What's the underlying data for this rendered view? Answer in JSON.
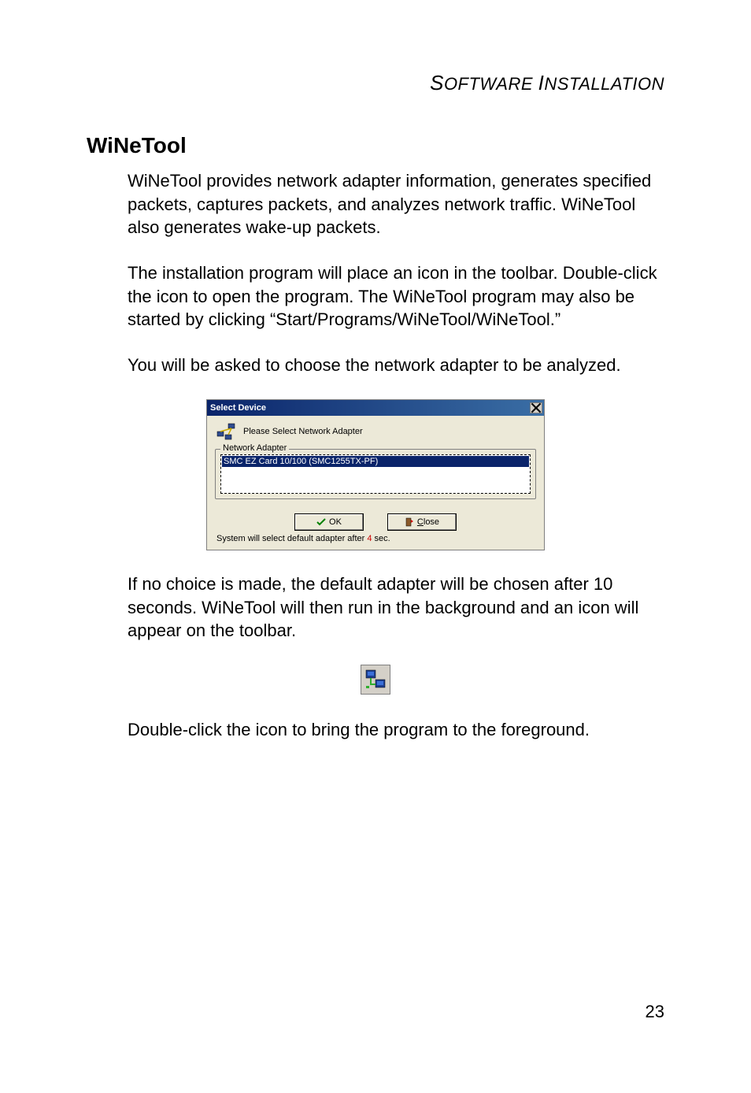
{
  "header": {
    "text_caps": "S",
    "text_rest1": "OFTWARE",
    "text_caps2": "I",
    "text_rest2": "NSTALLATION"
  },
  "section_title": "WiNeTool",
  "paragraphs": {
    "p1": "WiNeTool provides network adapter information, generates specified packets, captures packets, and analyzes network traffic. WiNeTool also generates wake-up packets.",
    "p2": "The installation program will place an icon in the toolbar. Double-click the icon to open the program. The WiNeTool program may also be started by clicking “Start/Programs/WiNeTool/WiNeTool.”",
    "p3": "You will be asked to choose the network adapter to be analyzed.",
    "p4": "If no choice is made, the default adapter will be chosen after 10 seconds. WiNeTool will then run in the background and an icon will appear on the toolbar.",
    "p5": "Double-click the icon to bring the program to the foreground."
  },
  "dialog": {
    "title": "Select Device",
    "prompt": "Please Select Network Adapter",
    "fieldset_label": "Network Adapter",
    "adapter_item": "SMC EZ Card 10/100 (SMC1255TX-PF)",
    "ok_label": "OK",
    "close_label": "Close",
    "close_prefix": "C",
    "close_rest": "lose",
    "status_prefix": "System will select default adapter after ",
    "status_count": "4",
    "status_suffix": " sec."
  },
  "page_number": "23"
}
